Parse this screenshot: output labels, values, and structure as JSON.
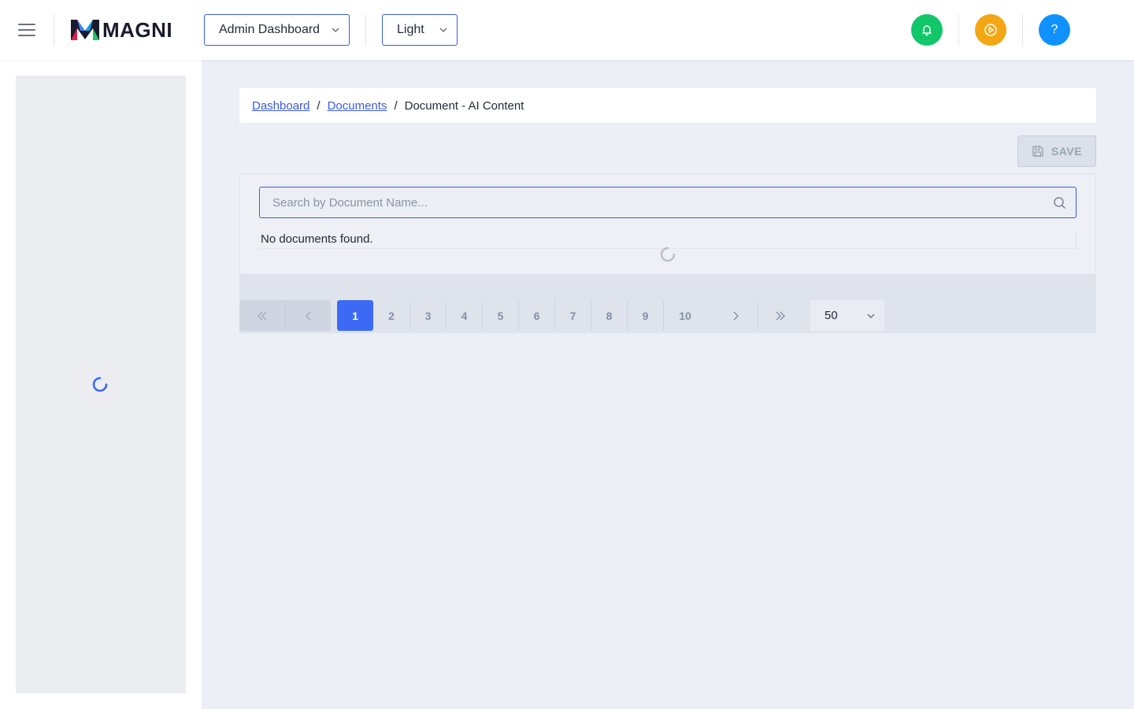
{
  "header": {
    "logo_text": "MAGNI",
    "dashboard_select": "Admin Dashboard",
    "theme_select": "Light",
    "help_label": "?"
  },
  "breadcrumb": {
    "items": [
      "Dashboard",
      "Documents"
    ],
    "current": "Document - AI Content"
  },
  "toolbar": {
    "save_label": "SAVE"
  },
  "search": {
    "placeholder": "Search by Document Name...",
    "value": ""
  },
  "documents": {
    "empty_message": "No documents found."
  },
  "pagination": {
    "pages": [
      "1",
      "2",
      "3",
      "4",
      "5",
      "6",
      "7",
      "8",
      "9",
      "10"
    ],
    "current_page": "1",
    "per_page": "50"
  },
  "colors": {
    "accent": "#3b5bdb",
    "notification": "#12c76a",
    "activity": "#f5a614",
    "help": "#0f92ff",
    "active_page": "#3d6af5"
  }
}
